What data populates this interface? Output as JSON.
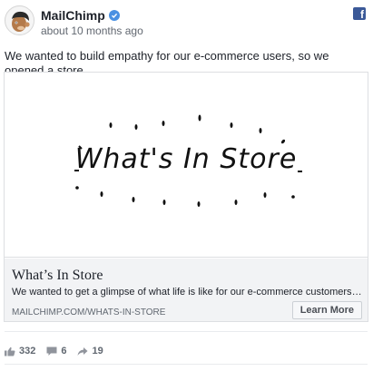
{
  "post": {
    "page_name": "MailChimp",
    "timestamp": "about 10 months ago",
    "message": "We wanted to build empathy for our e-commerce users, so we opened a store.",
    "platform_icon": "facebook-icon",
    "verified_icon": "verified-badge-icon"
  },
  "attachment": {
    "art_text": "What's In Store",
    "title": "What’s In Store",
    "description": "We wanted to get a glimpse of what life is like for our e-commerce customers, so we opened a store.",
    "domain": "MAILCHIMP.COM/WHATS-IN-STORE",
    "cta_label": "Learn More"
  },
  "stats": {
    "likes": "332",
    "comments": "6",
    "shares": "19"
  },
  "colors": {
    "facebook_blue": "#3b5998",
    "verified_blue": "#4a90e2",
    "link_background": "#f2f3f5"
  }
}
